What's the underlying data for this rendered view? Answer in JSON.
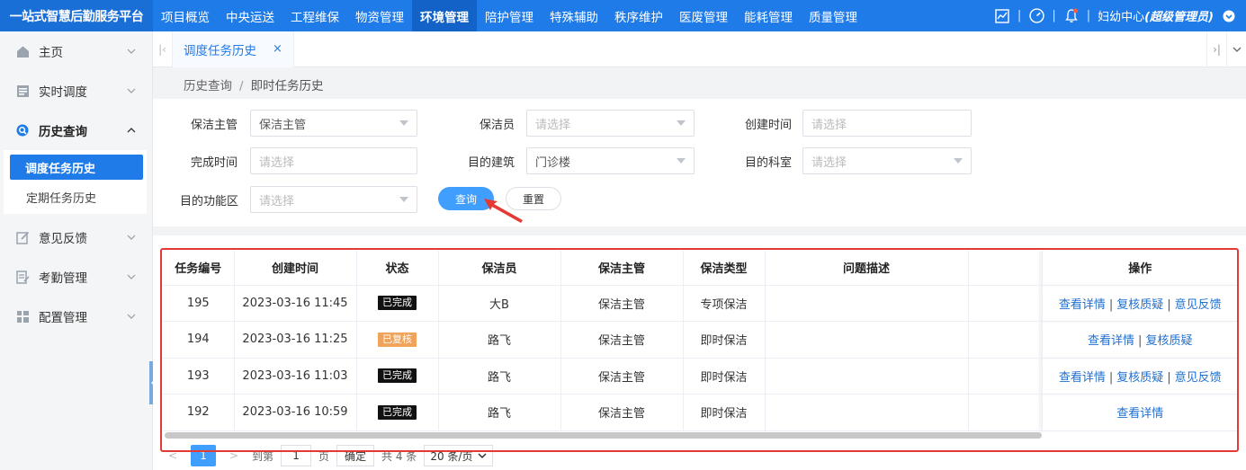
{
  "header": {
    "brand": "一站式智慧后勤服务平台",
    "nav": [
      "项目概览",
      "中央运送",
      "工程维保",
      "物资管理",
      "环境管理",
      "陪护管理",
      "特殊辅助",
      "秩序维护",
      "医废管理",
      "能耗管理",
      "质量管理"
    ],
    "active_nav_index": 4,
    "user": "妇幼中心",
    "role": "(超级管理员)",
    "sep": "|"
  },
  "sidebar": {
    "items": [
      {
        "label": "主页",
        "icon": "home-icon"
      },
      {
        "label": "实时调度",
        "icon": "dispatch-icon"
      },
      {
        "label": "历史查询",
        "icon": "search-icon"
      },
      {
        "label": "意见反馈",
        "icon": "edit-icon"
      },
      {
        "label": "考勤管理",
        "icon": "attendance-icon"
      },
      {
        "label": "配置管理",
        "icon": "grid-icon"
      }
    ],
    "submenu": [
      "调度任务历史",
      "定期任务历史"
    ]
  },
  "tabs": {
    "items": [
      {
        "label": "调度任务历史",
        "close": "×"
      }
    ]
  },
  "breadcrumb": {
    "parent": "历史查询",
    "separator": "/",
    "current": "即时任务历史"
  },
  "filters": {
    "supervisor": {
      "label": "保洁主管",
      "value": "保洁主管"
    },
    "cleaner": {
      "label": "保洁员",
      "placeholder": "请选择"
    },
    "created": {
      "label": "创建时间",
      "placeholder": "请选择"
    },
    "finished": {
      "label": "完成时间",
      "placeholder": "请选择"
    },
    "building": {
      "label": "目的建筑",
      "value": "门诊楼"
    },
    "department": {
      "label": "目的科室",
      "placeholder": "请选择"
    },
    "area": {
      "label": "目的功能区",
      "placeholder": "请选择"
    },
    "query_label": "查询",
    "reset_label": "重置"
  },
  "table": {
    "columns": [
      "任务编号",
      "创建时间",
      "状态",
      "保洁员",
      "保洁主管",
      "保洁类型",
      "问题描述",
      "",
      "操作"
    ],
    "rows": [
      {
        "id": "195",
        "created": "2023-03-16 11:45",
        "status": "已完成",
        "status_kind": "done",
        "cleaner": "大B",
        "supervisor": "保洁主管",
        "type": "专项保洁",
        "desc": "",
        "ops": [
          "查看详情",
          "复核质疑",
          "意见反馈"
        ]
      },
      {
        "id": "194",
        "created": "2023-03-16 11:25",
        "status": "已复核",
        "status_kind": "review",
        "cleaner": "路飞",
        "supervisor": "保洁主管",
        "type": "即时保洁",
        "desc": "",
        "ops": [
          "查看详情",
          "复核质疑"
        ]
      },
      {
        "id": "193",
        "created": "2023-03-16 11:03",
        "status": "已完成",
        "status_kind": "done",
        "cleaner": "路飞",
        "supervisor": "保洁主管",
        "type": "即时保洁",
        "desc": "",
        "ops": [
          "查看详情",
          "复核质疑",
          "意见反馈"
        ]
      },
      {
        "id": "192",
        "created": "2023-03-16 10:59",
        "status": "已完成",
        "status_kind": "done",
        "cleaner": "路飞",
        "supervisor": "保洁主管",
        "type": "即时保洁",
        "desc": "",
        "ops": [
          "查看详情"
        ]
      }
    ]
  },
  "pagination": {
    "prev": "<",
    "page": "1",
    "next": ">",
    "goto_label": "到第",
    "goto_value": "1",
    "page_unit": "页",
    "confirm_label": "确定",
    "total": "共 4 条",
    "page_size": "20 条/页"
  },
  "colors": {
    "primary": "#1f7be8",
    "button": "#409eff",
    "annotation": "#e53935"
  }
}
